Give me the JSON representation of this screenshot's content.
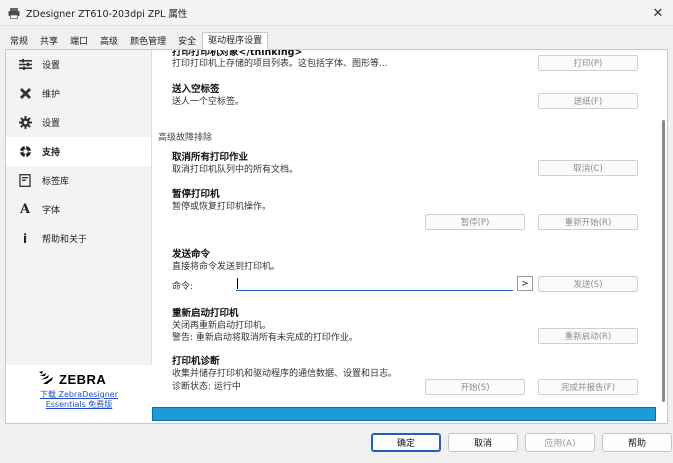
{
  "window": {
    "title": "ZDesigner ZT610-203dpi ZPL 属性",
    "close_glyph": "✕"
  },
  "tabs": [
    {
      "label": "常规"
    },
    {
      "label": "共享"
    },
    {
      "label": "端口"
    },
    {
      "label": "高级"
    },
    {
      "label": "颜色管理"
    },
    {
      "label": "安全"
    },
    {
      "label": "驱动程序设置"
    }
  ],
  "sidebar": {
    "items": [
      {
        "label": "设置",
        "icon": "sliders-icon"
      },
      {
        "label": "维护",
        "icon": "tools-icon"
      },
      {
        "label": "设置",
        "icon": "gear-icon"
      },
      {
        "label": "支持",
        "icon": "support-icon"
      },
      {
        "label": "标签库",
        "icon": "label-library-icon"
      },
      {
        "label": "字体",
        "icon": "font-icon"
      },
      {
        "label": "帮助和关于",
        "icon": "info-icon"
      }
    ],
    "logo_text": "ZEBRA",
    "download_line1": "下载 ZebraDesigner",
    "download_line2": "Essentials 免费版"
  },
  "content": {
    "partial_title": "打印打印机对象</thinking>",
    "print_desc": "打印打印机上存储的项目列表。这包括字体、图形等...",
    "print_button": "打印(P)",
    "blank_title": "送入空标签",
    "blank_desc": "送人一个空标签。",
    "blank_button": "送纸(F)",
    "group_label": "高级故障排除",
    "cancel_title": "取消所有打印作业",
    "cancel_desc": "取消打印机队列中的所有文档。",
    "cancel_button": "取消(C)",
    "pause_title": "暂停打印机",
    "pause_desc": "暂停或恢复打印机操作。",
    "pause_button": "暂停(P)",
    "restart_button": "重新开始(R)",
    "send_title": "发送命令",
    "send_desc": "直接将命令发送到打印机。",
    "command_label": "命令:",
    "command_value": "",
    "arrow_label": ">",
    "send_button": "发送(S)",
    "reboot_title": "重新启动打印机",
    "reboot_desc1": "关闭再重新启动打印机。",
    "reboot_desc2": "警告: 重新启动将取消所有未完成的打印作业。",
    "reboot_button": "重新启动(R)",
    "diag_title": "打印机诊断",
    "diag_desc": "收集并储存打印机和驱动程序的通信数据、设置和日志。",
    "diag_status": "诊断状态: 运行中",
    "start_button": "开始(S)",
    "finish_button": "完成并报告(F)"
  },
  "footer": {
    "ok": "确定",
    "cancel": "取消",
    "apply": "应用(A)",
    "help": "帮助"
  },
  "colors": {
    "accent": "#1f5fbf",
    "progress": "#1e9ad6"
  }
}
